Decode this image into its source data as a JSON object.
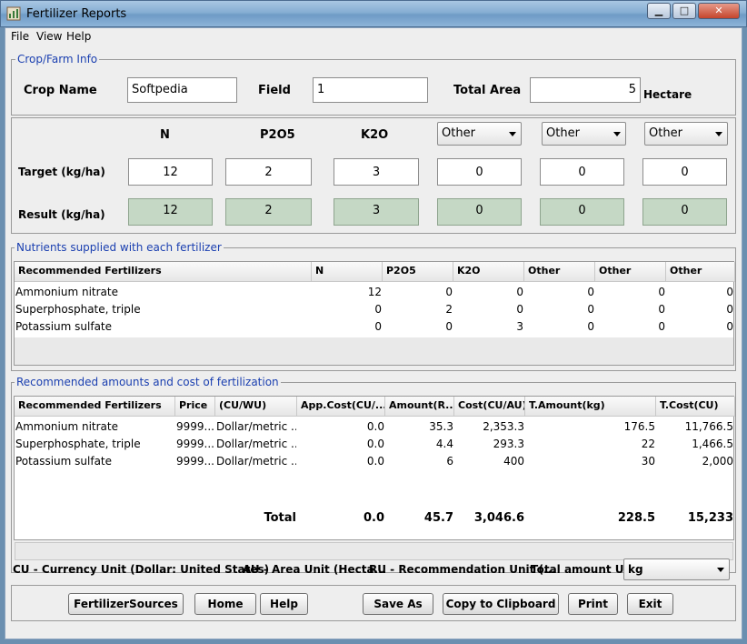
{
  "window": {
    "title": "Fertilizer Reports",
    "minimize": "▁",
    "maximize": "□",
    "close": "✕"
  },
  "menu": [
    "File",
    "View",
    "Help"
  ],
  "crop": {
    "legend": "Crop/Farm Info",
    "crop_name_label": "Crop Name",
    "crop_name_value": "Softpedia",
    "field_label": "Field",
    "field_value": "1",
    "total_area_label": "Total Area",
    "total_area_value": "5",
    "area_unit": "Hectare"
  },
  "nutrients": {
    "headers": [
      "N",
      "P2O5",
      "K2O"
    ],
    "other_selects": [
      "Other",
      "Other",
      "Other"
    ],
    "target_label": "Target (kg/ha)",
    "result_label": "Result (kg/ha)",
    "target": [
      "12",
      "2",
      "3",
      "0",
      "0",
      "0"
    ],
    "result": [
      "12",
      "2",
      "3",
      "0",
      "0",
      "0"
    ]
  },
  "supplied": {
    "legend": "Nutrients supplied with each fertilizer",
    "columns": [
      "Recommended Fertilizers",
      "N",
      "P2O5",
      "K2O",
      "Other",
      "Other",
      "Other"
    ],
    "rows": [
      [
        "Ammonium nitrate",
        "12",
        "0",
        "0",
        "0",
        "0",
        "0"
      ],
      [
        "Superphosphate, triple",
        "0",
        "2",
        "0",
        "0",
        "0",
        "0"
      ],
      [
        "Potassium sulfate",
        "0",
        "0",
        "3",
        "0",
        "0",
        "0"
      ]
    ]
  },
  "cost": {
    "legend": "Recommended amounts and cost of fertilization",
    "columns": [
      "Recommended Fertilizers",
      "Price",
      "(CU/WU)",
      "App.Cost(CU/...",
      "Amount(R...",
      "Cost(CU/AU)",
      "T.Amount(kg)",
      "T.Cost(CU)"
    ],
    "rows": [
      [
        "Ammonium nitrate",
        "9999...",
        "Dollar/metric ...",
        "0.0",
        "35.3",
        "2,353.3",
        "176.5",
        "11,766.5"
      ],
      [
        "Superphosphate, triple",
        "9999...",
        "Dollar/metric ...",
        "0.0",
        "4.4",
        "293.3",
        "22",
        "1,466.5"
      ],
      [
        "Potassium sulfate",
        "9999...",
        "Dollar/metric ...",
        "0.0",
        "6",
        "400",
        "30",
        "2,000"
      ]
    ],
    "total": [
      "Total",
      "0.0",
      "45.7",
      "3,046.6",
      "228.5",
      "15,233"
    ]
  },
  "footer": {
    "cu": "CU - Currency Unit (Dollar: United States)",
    "au": "AU - Area Unit (Hecta...",
    "ru": "RU - Recommendation Unit (...",
    "total_unit_label": "Total amount Unit",
    "total_unit_value": "kg"
  },
  "buttons": [
    "FertilizerSources",
    "Home",
    "Help",
    "Save As",
    "Copy to Clipboard",
    "Print",
    "Exit"
  ]
}
